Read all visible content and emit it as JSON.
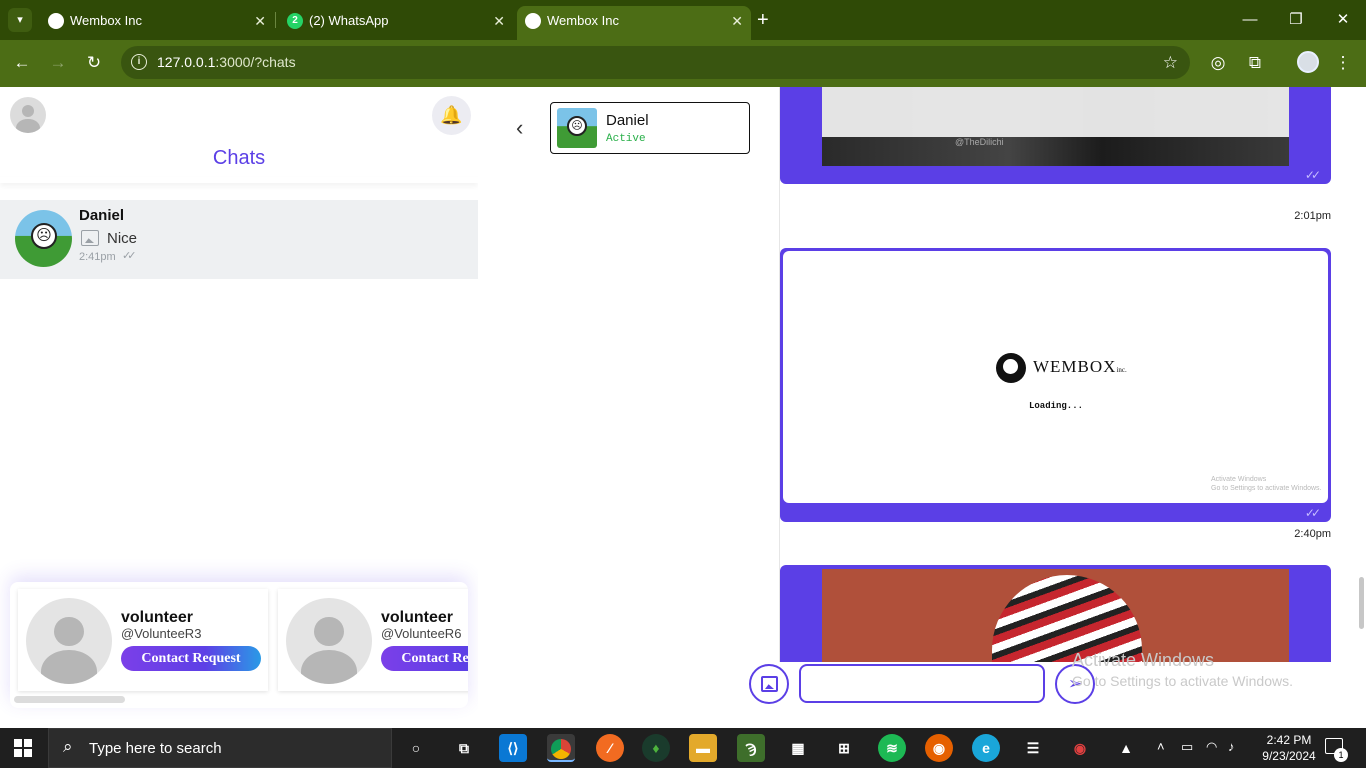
{
  "browser": {
    "tabs": [
      {
        "title": "Wembox Inc"
      },
      {
        "title": "(2) WhatsApp",
        "badge": "2"
      },
      {
        "title": "Wembox Inc"
      }
    ],
    "url_host": "127.0.0.1",
    "url_rest": ":3000/?chats",
    "icons": [
      "tab-search-icon",
      "close-icon",
      "new-tab-icon",
      "minimize-icon",
      "restore-icon",
      "window-close-icon",
      "back-icon",
      "forward-icon",
      "reload-icon",
      "site-info-icon",
      "bookmark-star-icon",
      "extension-icon",
      "puzzle-icon",
      "profile-icon",
      "menu-icon"
    ]
  },
  "sidebar": {
    "title": "Chats",
    "chats": [
      {
        "name": "Daniel",
        "preview": "Nice",
        "time": "2:41pm"
      }
    ],
    "suggestions": [
      {
        "name": "volunteer",
        "handle": "@VolunteeR3",
        "button": "Contact Request"
      },
      {
        "name": "volunteer",
        "handle": "@VolunteeR6",
        "button": "Contact Request"
      }
    ]
  },
  "conversation": {
    "contact_name": "Daniel",
    "contact_status": "Active",
    "messages": [
      {
        "time": "2:01pm",
        "watermark": "@TheDilichi"
      },
      {
        "time": "2:40pm",
        "brand": "WEMBOX",
        "brand_suffix": "inc.",
        "loading_text": "Loading...",
        "overlay_line1": "Activate Windows",
        "overlay_line2": "Go to Settings to activate Windows."
      },
      {
        "time": ""
      }
    ],
    "input_value": ""
  },
  "watermark": {
    "line1": "Activate Windows",
    "line2": "Go to Settings to activate Windows."
  },
  "taskbar": {
    "search_placeholder": "Type here to search",
    "time": "2:42 PM",
    "date": "9/23/2024",
    "notification_count": "1"
  },
  "colors": {
    "accent": "#5b3fe6",
    "browser_frame": "#2f4a06",
    "browser_toolbar": "#4c6d15",
    "status_active": "#2ab04a"
  }
}
